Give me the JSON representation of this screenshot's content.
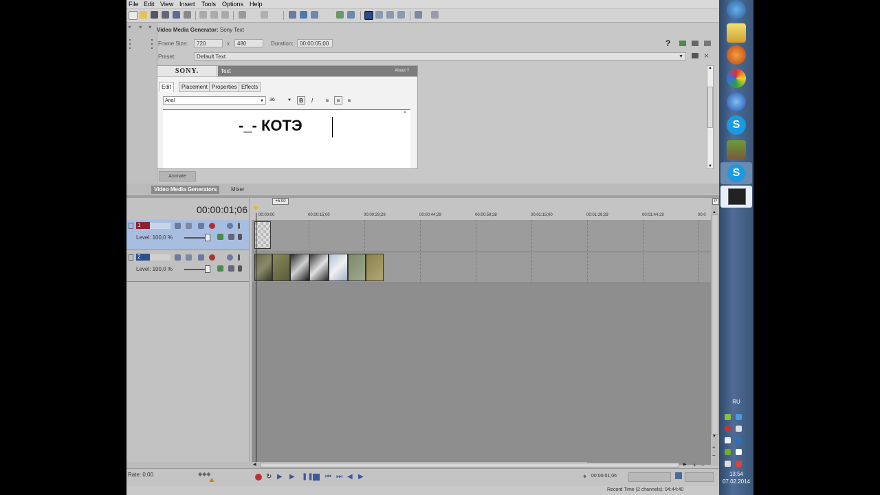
{
  "menu": [
    "File",
    "Edit",
    "View",
    "Insert",
    "Tools",
    "Options",
    "Help"
  ],
  "generator": {
    "header_bold": "Video Media Generator:",
    "header_name": "Sony Text",
    "frame_size_label": "Frame Size:",
    "width": "720",
    "x_sep": "x",
    "height": "480",
    "duration_label": "Duration:",
    "duration": "00:00:05;00",
    "preset_label": "Preset:",
    "preset": "Default Text",
    "brand": "SONY.",
    "plugin_title": "Text",
    "about": "About",
    "about_q": "?",
    "tabs": [
      "Edit",
      "Placement",
      "Properties",
      "Effects"
    ],
    "font": "Arial",
    "size": "36",
    "bold": "B",
    "italic": "I",
    "text": "-_- КОТЭ",
    "animate": "Animate"
  },
  "panel_tabs": [
    "Video Media Generators",
    "Mixer"
  ],
  "timeline": {
    "timecode": "00:00:01;06",
    "region_marker": "+5:00",
    "ruler": [
      "00:00:00",
      "00:00:15;00",
      "00:00:29;29",
      "00:00:44;29",
      "00:00:59;28",
      "00:01:15;00",
      "00:01:29;29",
      "00:01:44;29",
      "00:0"
    ],
    "tracks": [
      {
        "num": "1",
        "level": "Level: 100,0 %"
      },
      {
        "num": "2",
        "level": "Level: 100,0 %"
      }
    ]
  },
  "transport": {
    "rate": "Rate: 0,00",
    "timecode": "00:00:01;06",
    "record_time": "Record Time (2 channels): 04:44:40"
  },
  "taskbar": {
    "lang": "RU",
    "time": "13:54",
    "date": "07.02.2014"
  },
  "colors": {
    "accent_track1": "#a8bee0",
    "video_track_header": "#8a2130",
    "audio_track_header": "#2a4f8a"
  }
}
